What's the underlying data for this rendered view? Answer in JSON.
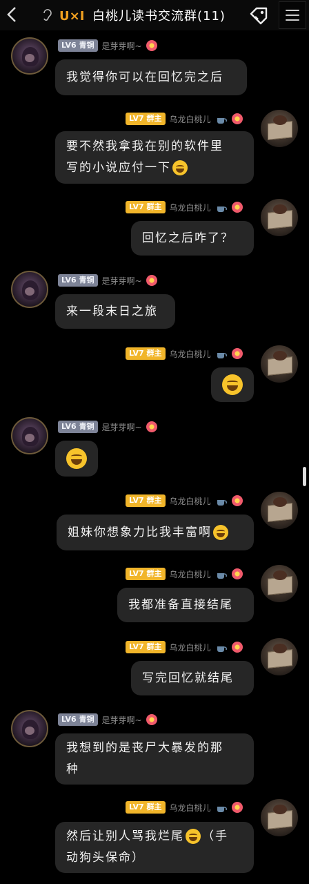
{
  "header": {
    "title": "白桃儿读书交流群(11)",
    "logo_text": "U×I",
    "back_icon": "chevron-left-icon",
    "menu_icon": "hamburger-menu-icon"
  },
  "members": {
    "a": {
      "level": "LV6 青铜",
      "nick": "是芽芽啊~"
    },
    "b": {
      "level": "LV7 群主",
      "nick": "乌龙白桃儿"
    }
  },
  "messages": [
    {
      "text": "我觉得你可以在回忆完之后"
    },
    {
      "text": "要不然我拿我在别的软件里\n写的小说应付一下"
    },
    {
      "text": "回忆之后咋了？"
    },
    {
      "text": "来一段末日之旅"
    },
    {
      "text": ""
    },
    {
      "text": ""
    },
    {
      "text": "姐妹你想象力比我丰富啊"
    },
    {
      "text": "我都准备直接结尾"
    },
    {
      "text": "写完回忆就结尾"
    },
    {
      "text": "我想到的是丧尸大暴发的那\n种"
    },
    {
      "text": "然后让别人骂我烂尾",
      "text2": "（手\n动狗头保命）"
    }
  ],
  "colors": {
    "background": "#000000",
    "bubble": "#262626",
    "lv6_badge": "#7d8397",
    "lv7_badge": "#f1b52a"
  }
}
